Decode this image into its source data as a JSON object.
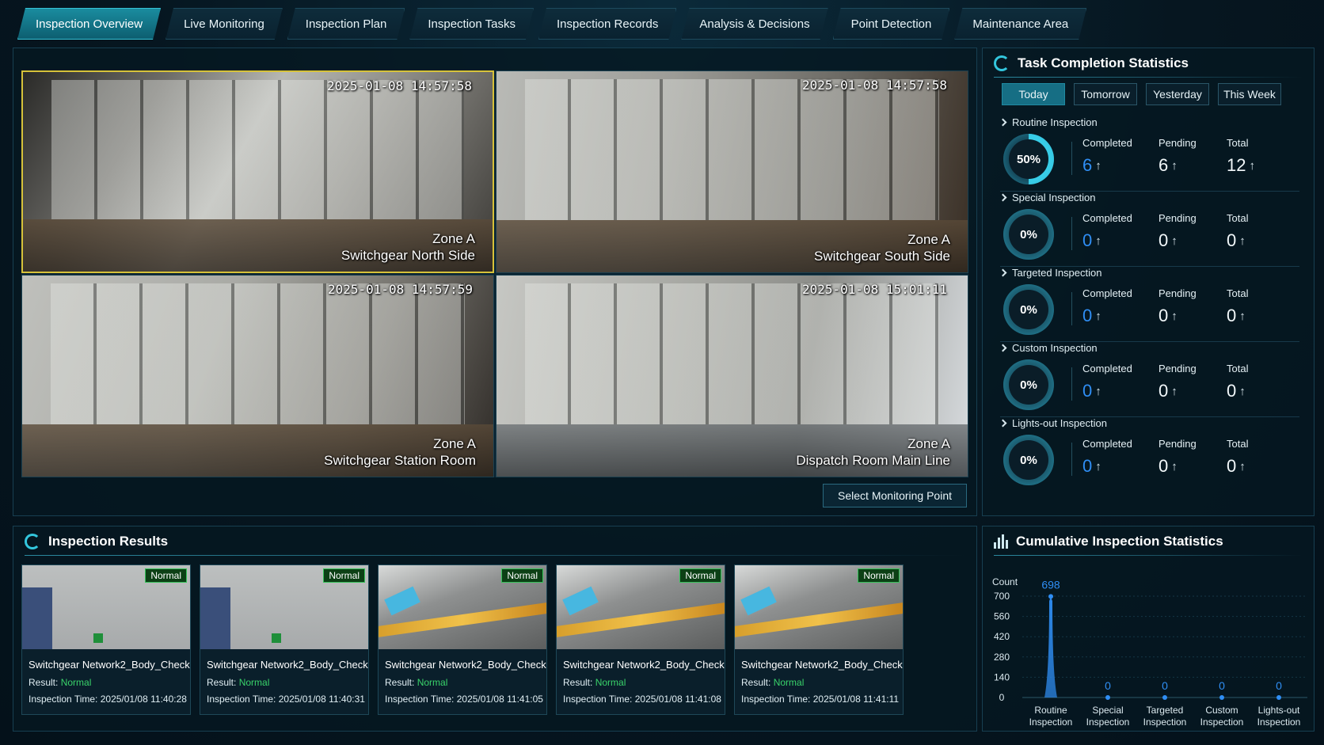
{
  "tabs": [
    {
      "label": "Inspection Overview"
    },
    {
      "label": "Live Monitoring"
    },
    {
      "label": "Inspection Plan"
    },
    {
      "label": "Inspection Tasks"
    },
    {
      "label": "Inspection Records"
    },
    {
      "label": "Analysis & Decisions"
    },
    {
      "label": "Point Detection"
    },
    {
      "label": "Maintenance Area"
    }
  ],
  "cameras": [
    {
      "time": "2025-01-08 14:57:58",
      "zone": "Zone A",
      "location": "Switchgear North Side"
    },
    {
      "time": "2025-01-08 14:57:58",
      "zone": "Zone A",
      "location": "Switchgear South Side"
    },
    {
      "time": "2025-01-08 14:57:59",
      "zone": "Zone A",
      "location": "Switchgear Station Room"
    },
    {
      "time": "2025-01-08 15:01:11",
      "zone": "Zone A",
      "location": "Dispatch Room Main Line"
    }
  ],
  "select_point_label": "Select Monitoring Point",
  "task_stats": {
    "title": "Task Completion Statistics",
    "periods": [
      "Today",
      "Tomorrow",
      "Yesterday",
      "This Week"
    ],
    "col_completed": "Completed",
    "col_pending": "Pending",
    "col_total": "Total",
    "categories": [
      {
        "name": "Routine Inspection",
        "percent": "50%",
        "completed": "6",
        "pending": "6",
        "total": "12"
      },
      {
        "name": "Special Inspection",
        "percent": "0%",
        "completed": "0",
        "pending": "0",
        "total": "0"
      },
      {
        "name": "Targeted Inspection",
        "percent": "0%",
        "completed": "0",
        "pending": "0",
        "total": "0"
      },
      {
        "name": "Custom Inspection",
        "percent": "0%",
        "completed": "0",
        "pending": "0",
        "total": "0"
      },
      {
        "name": "Lights-out Inspection",
        "percent": "0%",
        "completed": "0",
        "pending": "0",
        "total": "0"
      }
    ]
  },
  "results": {
    "title": "Inspection Results",
    "result_prefix": "Result: ",
    "time_prefix": "Inspection Time: ",
    "items": [
      {
        "badge": "Normal",
        "name": "Switchgear Network2_Body_Check",
        "result": "Normal",
        "time": "2025/01/08 11:40:28"
      },
      {
        "badge": "Normal",
        "name": "Switchgear Network2_Body_Check",
        "result": "Normal",
        "time": "2025/01/08 11:40:31"
      },
      {
        "badge": "Normal",
        "name": "Switchgear Network2_Body_Check",
        "result": "Normal",
        "time": "2025/01/08 11:41:05"
      },
      {
        "badge": "Normal",
        "name": "Switchgear Network2_Body_Check",
        "result": "Normal",
        "time": "2025/01/08 11:41:08"
      },
      {
        "badge": "Normal",
        "name": "Switchgear Network2_Body_Check",
        "result": "Normal",
        "time": "2025/01/08 11:41:11"
      }
    ]
  },
  "cumulative": {
    "title": "Cumulative Inspection Statistics"
  },
  "chart_data": {
    "type": "area",
    "ylabel": "Count",
    "categories": [
      [
        "Routine",
        "Inspection"
      ],
      [
        "Special",
        "Inspection"
      ],
      [
        "Targeted",
        "Inspection"
      ],
      [
        "Custom",
        "Inspection"
      ],
      [
        "Lights-out",
        "Inspection"
      ]
    ],
    "values": [
      698,
      0,
      0,
      0,
      0
    ],
    "data_labels": [
      "698",
      "0",
      "0",
      "0",
      "0"
    ],
    "ylim": [
      0,
      700
    ],
    "yticks": [
      "0",
      "140",
      "280",
      "420",
      "560",
      "700"
    ],
    "color": "#2f8ef4"
  }
}
